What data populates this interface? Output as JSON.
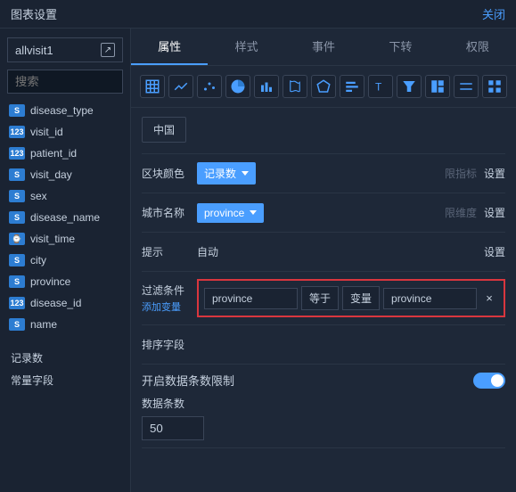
{
  "titlebar": {
    "title": "图表设置",
    "close": "关闭"
  },
  "sidebar": {
    "dataset_name": "allvisit1",
    "search_placeholder": "搜索",
    "fields": [
      {
        "icon": "S",
        "name": "disease_type"
      },
      {
        "icon": "123",
        "name": "visit_id"
      },
      {
        "icon": "123",
        "name": "patient_id"
      },
      {
        "icon": "S",
        "name": "visit_day"
      },
      {
        "icon": "S",
        "name": "sex"
      },
      {
        "icon": "S",
        "name": "disease_name"
      },
      {
        "icon": "⌚",
        "name": "visit_time"
      },
      {
        "icon": "S",
        "name": "city"
      },
      {
        "icon": "S",
        "name": "province"
      },
      {
        "icon": "123",
        "name": "disease_id"
      },
      {
        "icon": "S",
        "name": "name"
      }
    ],
    "extras": [
      "记录数",
      "常量字段"
    ]
  },
  "tabs": [
    "属性",
    "样式",
    "事件",
    "下转",
    "权限"
  ],
  "chart_types": [
    "table",
    "line",
    "scatter",
    "pie",
    "bar",
    "map",
    "polygon",
    "hbar",
    "text",
    "funnel",
    "split",
    "range",
    "grid"
  ],
  "config": {
    "region_chip": "中国",
    "block_color": {
      "label": "区块颜色",
      "value": "记录数",
      "hint": "限指标",
      "action": "设置"
    },
    "city_name": {
      "label": "城市名称",
      "value": "province",
      "hint": "限维度",
      "action": "设置"
    },
    "tooltip": {
      "label": "提示",
      "value": "自动",
      "action": "设置"
    },
    "filter": {
      "label": "过滤条件",
      "add": "添加变量",
      "field": "province",
      "op": "等于",
      "type": "变量",
      "var": "province"
    },
    "sort": {
      "label": "排序字段"
    },
    "limit": {
      "label": "开启数据条数限制",
      "count_label": "数据条数",
      "count": "50"
    }
  }
}
